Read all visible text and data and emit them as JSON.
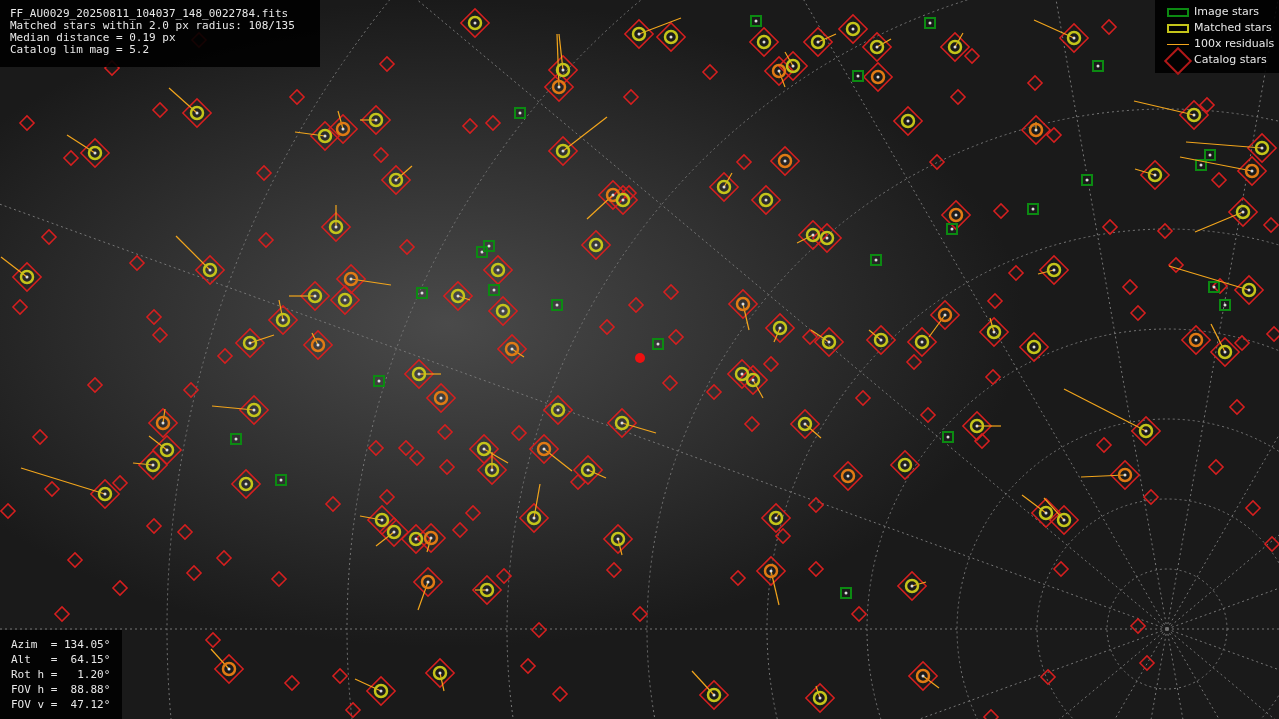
{
  "info_lines": [
    "FF_AU0029_20250811_104037_148_0022784.fits",
    "Matched stars within 2.0 px radius: 108/135",
    "Median distance = 0.19 px",
    "Catalog lim mag = 5.2"
  ],
  "legend": [
    {
      "kind": "image",
      "label": "Image stars"
    },
    {
      "kind": "matched",
      "label": "Matched stars"
    },
    {
      "kind": "residual",
      "label": "100x residuals"
    },
    {
      "kind": "catalog",
      "label": "Catalog stars"
    }
  ],
  "pointing": [
    "Azim  = 134.05°",
    "Alt   =  64.15°",
    "Rot h =   1.20°",
    "FOV h =  88.88°",
    "FOV v =  47.12°"
  ]
}
